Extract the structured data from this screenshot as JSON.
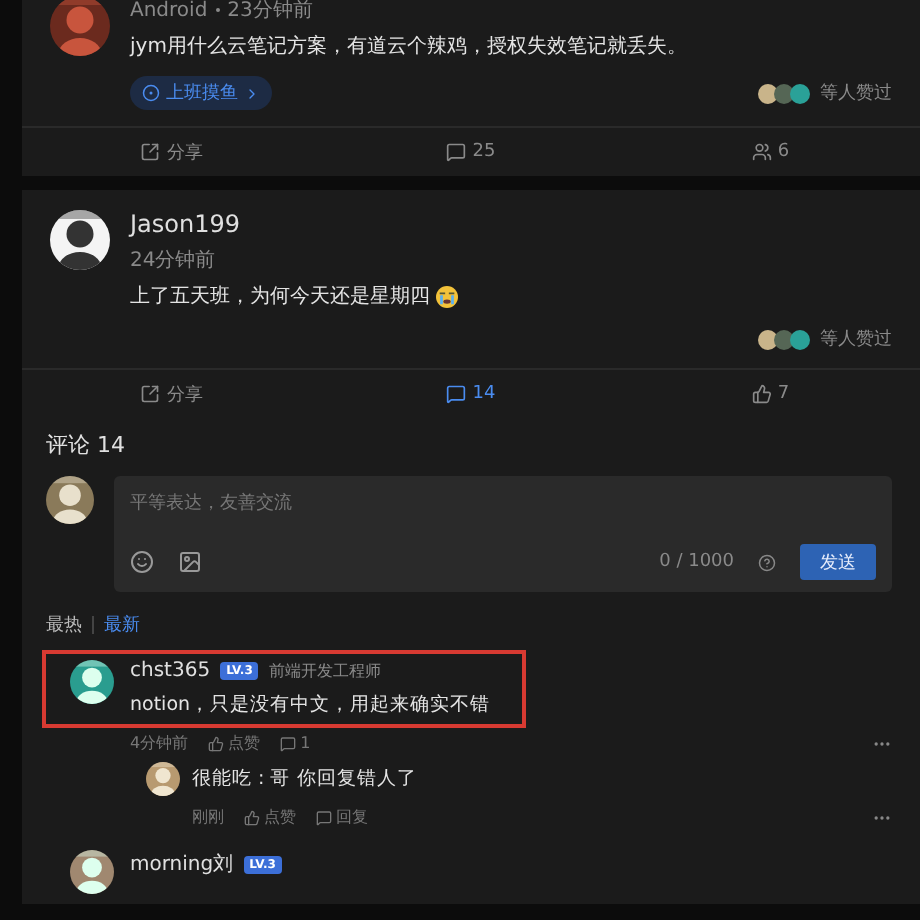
{
  "posts": [
    {
      "source": "Android",
      "time": "23分钟前",
      "content": "jym用什么云笔记方案，有道云个辣鸡，授权失效笔记就丢失。",
      "topic": "上班摸鱼",
      "likers_text": "等人赞过",
      "actions": [
        {
          "kind": "share",
          "label": "分享",
          "active": false
        },
        {
          "kind": "comment",
          "label": "25",
          "active": false
        },
        {
          "kind": "people",
          "label": "6",
          "active": false
        }
      ]
    },
    {
      "author": "Jason199",
      "time": "24分钟前",
      "content": "上了五天班，为何今天还是星期四",
      "trailing_emoji": true,
      "likers_text": "等人赞过",
      "actions": [
        {
          "kind": "share",
          "label": "分享",
          "active": false
        },
        {
          "kind": "comment",
          "label": "14",
          "active": true
        },
        {
          "kind": "like",
          "label": "7",
          "active": false
        }
      ]
    }
  ],
  "comments_section": {
    "title": "评论 14",
    "editor": {
      "placeholder": "平等表达，友善交流",
      "counter": "0 / 1000",
      "submit": "发送"
    },
    "sort_tabs": [
      {
        "label": "最热",
        "selected": false
      },
      {
        "label": "最新",
        "selected": true
      }
    ],
    "comments": [
      {
        "author": "chst365",
        "level": "LV.3",
        "title": "前端开发工程师",
        "content": "notion，只是没有中文，用起来确实不错",
        "highlighted": true,
        "time": "4分钟前",
        "like": "点赞",
        "reply_count": "1",
        "replies": [
          {
            "text": "很能吃 : 哥 你回复错人了",
            "time": "刚刚",
            "like": "点赞",
            "reply": "回复"
          }
        ]
      },
      {
        "author": "morning刘",
        "level": "LV.3",
        "highlighted": false
      }
    ]
  }
}
